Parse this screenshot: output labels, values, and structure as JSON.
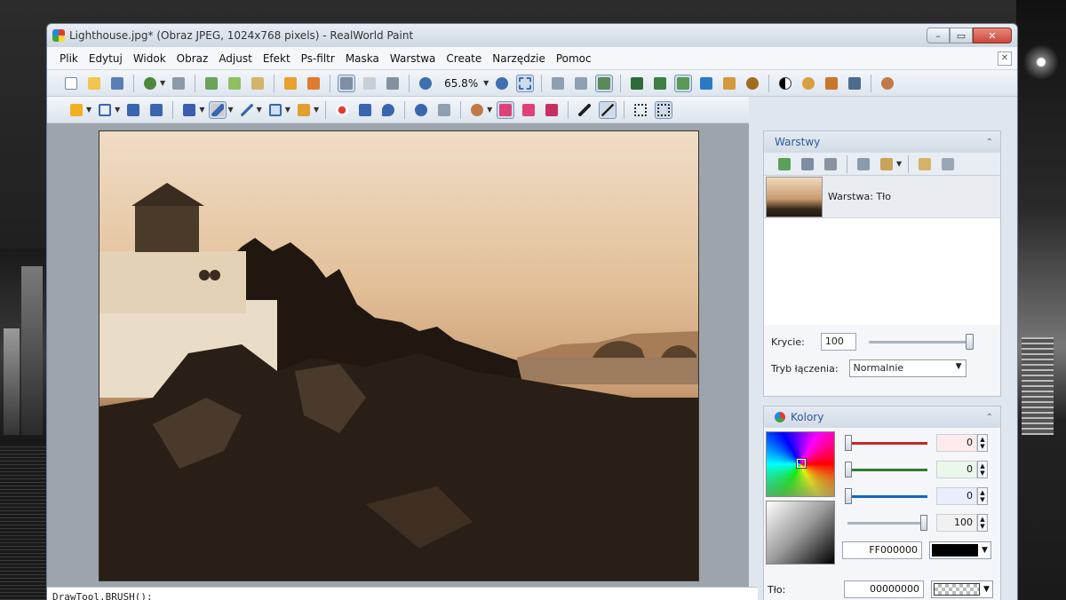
{
  "window": {
    "title": "Lighthouse.jpg* (Obraz JPEG, 1024x768 pixels) - RealWorld Paint"
  },
  "menu": [
    "Plik",
    "Edytuj",
    "Widok",
    "Obraz",
    "Adjust",
    "Efekt",
    "Ps-filtr",
    "Maska",
    "Warstwa",
    "Create",
    "Narzędzie",
    "Pomoc"
  ],
  "toolbar": {
    "zoom": "65.8%"
  },
  "status": {
    "command": "DrawTool.BRUSH();"
  },
  "layers_panel": {
    "title": "Warstwy",
    "layer_name": "Warstwa: Tło",
    "opacity_label": "Krycie:",
    "opacity_value": "100",
    "opacity_level": 1.0,
    "blend_label": "Tryb łączenia:",
    "blend_value": "Normalnie"
  },
  "colors_panel": {
    "title": "Kolory",
    "red": "0",
    "green": "0",
    "blue": "0",
    "alpha": "100",
    "fg_hex": "FF000000",
    "bg_label": "Tło:",
    "bg_hex": "00000000",
    "channel_colors": [
      "#c62828",
      "#2e7d32",
      "#1565c0"
    ],
    "palette": [
      "#000000",
      "#555555",
      "#f2c200",
      "#ffffff",
      "#cccccc",
      "#e53955",
      "#e88",
      "#22b0c8",
      "#f0a020",
      "#f6a3b0",
      "#6d8f8d",
      "#1e88e5",
      "#f0a060",
      "#e63030",
      "#22cc44",
      "#ff3333",
      "#ffee00"
    ]
  }
}
